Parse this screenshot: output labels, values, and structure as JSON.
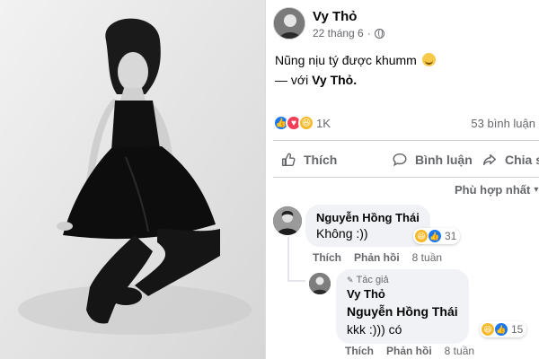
{
  "post": {
    "author": "Vy Thỏ",
    "date": "22 tháng 6",
    "privacy_separator": "·",
    "text_line1": "Nũng nịu tý được khumm",
    "text_line2_prefix": "— với",
    "text_line2_tag": "Vy Thỏ."
  },
  "reactions": {
    "count": "1K",
    "comments": "53 bình luận",
    "icons": [
      "like-icon",
      "love-icon",
      "haha-icon"
    ]
  },
  "actions": {
    "like": "Thích",
    "comment": "Bình luận",
    "share": "Chia sẻ"
  },
  "sort": {
    "label": "Phù hợp nhất"
  },
  "comments": [
    {
      "name": "Nguyễn Hồng Thái",
      "text": "Không :))",
      "reaction_count": "31",
      "like_label": "Thích",
      "reply_label": "Phản hồi",
      "time": "8 tuần"
    },
    {
      "author_tag": "Tác giả",
      "name": "Vy Thỏ",
      "mention": "Nguyễn Hồng Thái",
      "text": "kkk :))) có",
      "reaction_count": "15",
      "like_label": "Thích",
      "reply_label": "Phản hồi",
      "time": "8 tuần"
    }
  ],
  "colors": {
    "like_blue": "#1877f2",
    "love_red": "#f33e58",
    "haha_yellow": "#f7b928",
    "secondary_text": "#65676b",
    "bubble_bg": "#f0f2f5"
  }
}
